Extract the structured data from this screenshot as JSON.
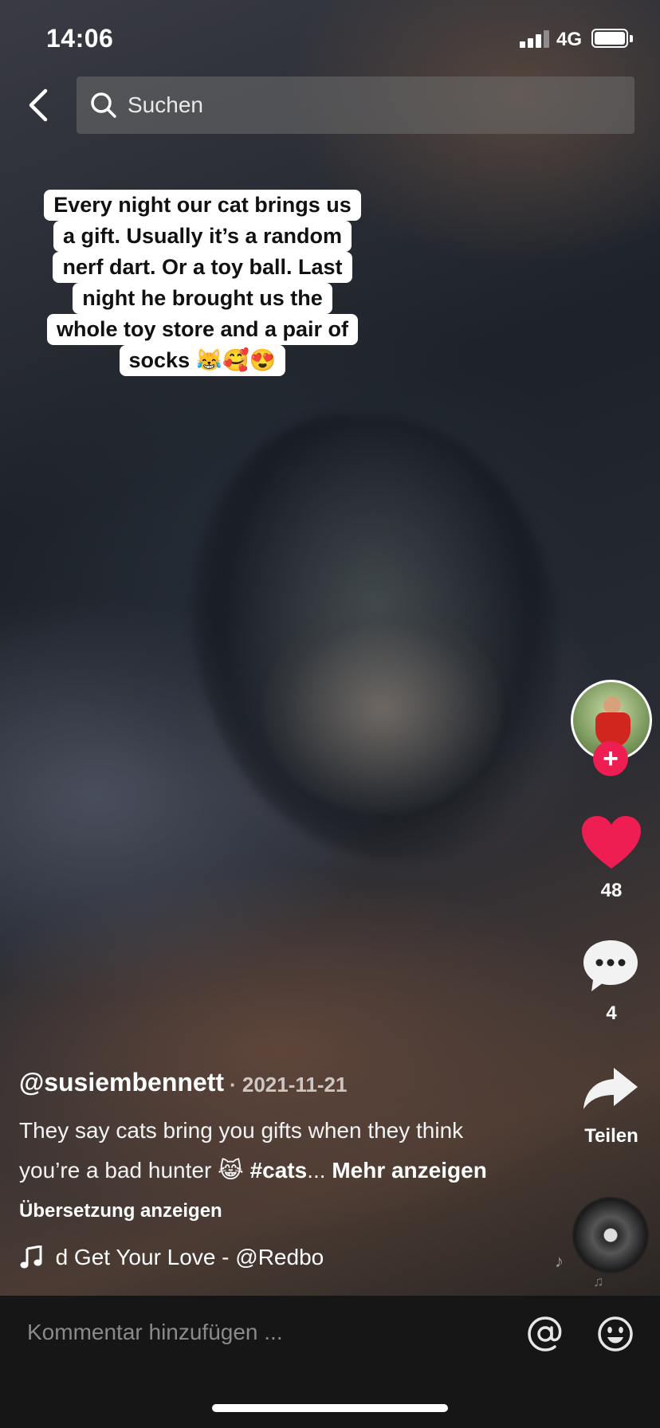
{
  "status_bar": {
    "time": "14:06",
    "network": "4G"
  },
  "search": {
    "placeholder": "Suchen"
  },
  "caption_overlay": {
    "lines": [
      "Every night our cat brings us",
      "a gift. Usually it’s a random",
      "nerf dart. Or a toy ball. Last",
      "night he brought us the",
      "whole toy store and a pair of",
      "socks 😹🥰😍"
    ]
  },
  "actions": {
    "likes": "48",
    "comments": "4",
    "share_label": "Teilen",
    "follow_symbol": "+"
  },
  "post": {
    "username": "@susiembennett",
    "date": "· 2021-11-21",
    "description_text": "They say cats bring you gifts when they think you’re a bad hunter 😹 ",
    "hashtag": "#cats",
    "ellipsis": "...",
    "more_label": "Mehr anzeigen",
    "translation_label": "Übersetzung anzeigen",
    "sound": "nd Get Your Love - @Redbo"
  },
  "comment_bar": {
    "placeholder": "Kommentar hinzufügen ..."
  },
  "colors": {
    "like": "#ee1d52",
    "follow_badge": "#ee1d52",
    "comment_bar_bg": "#161616"
  },
  "icons": {
    "back": "chevron-left-icon",
    "search": "search-icon",
    "like": "heart-icon",
    "comment": "speech-bubble-icon",
    "share": "share-arrow-icon",
    "sound": "music-note-icon",
    "mention": "at-sign-icon",
    "emoji": "smiley-icon"
  }
}
